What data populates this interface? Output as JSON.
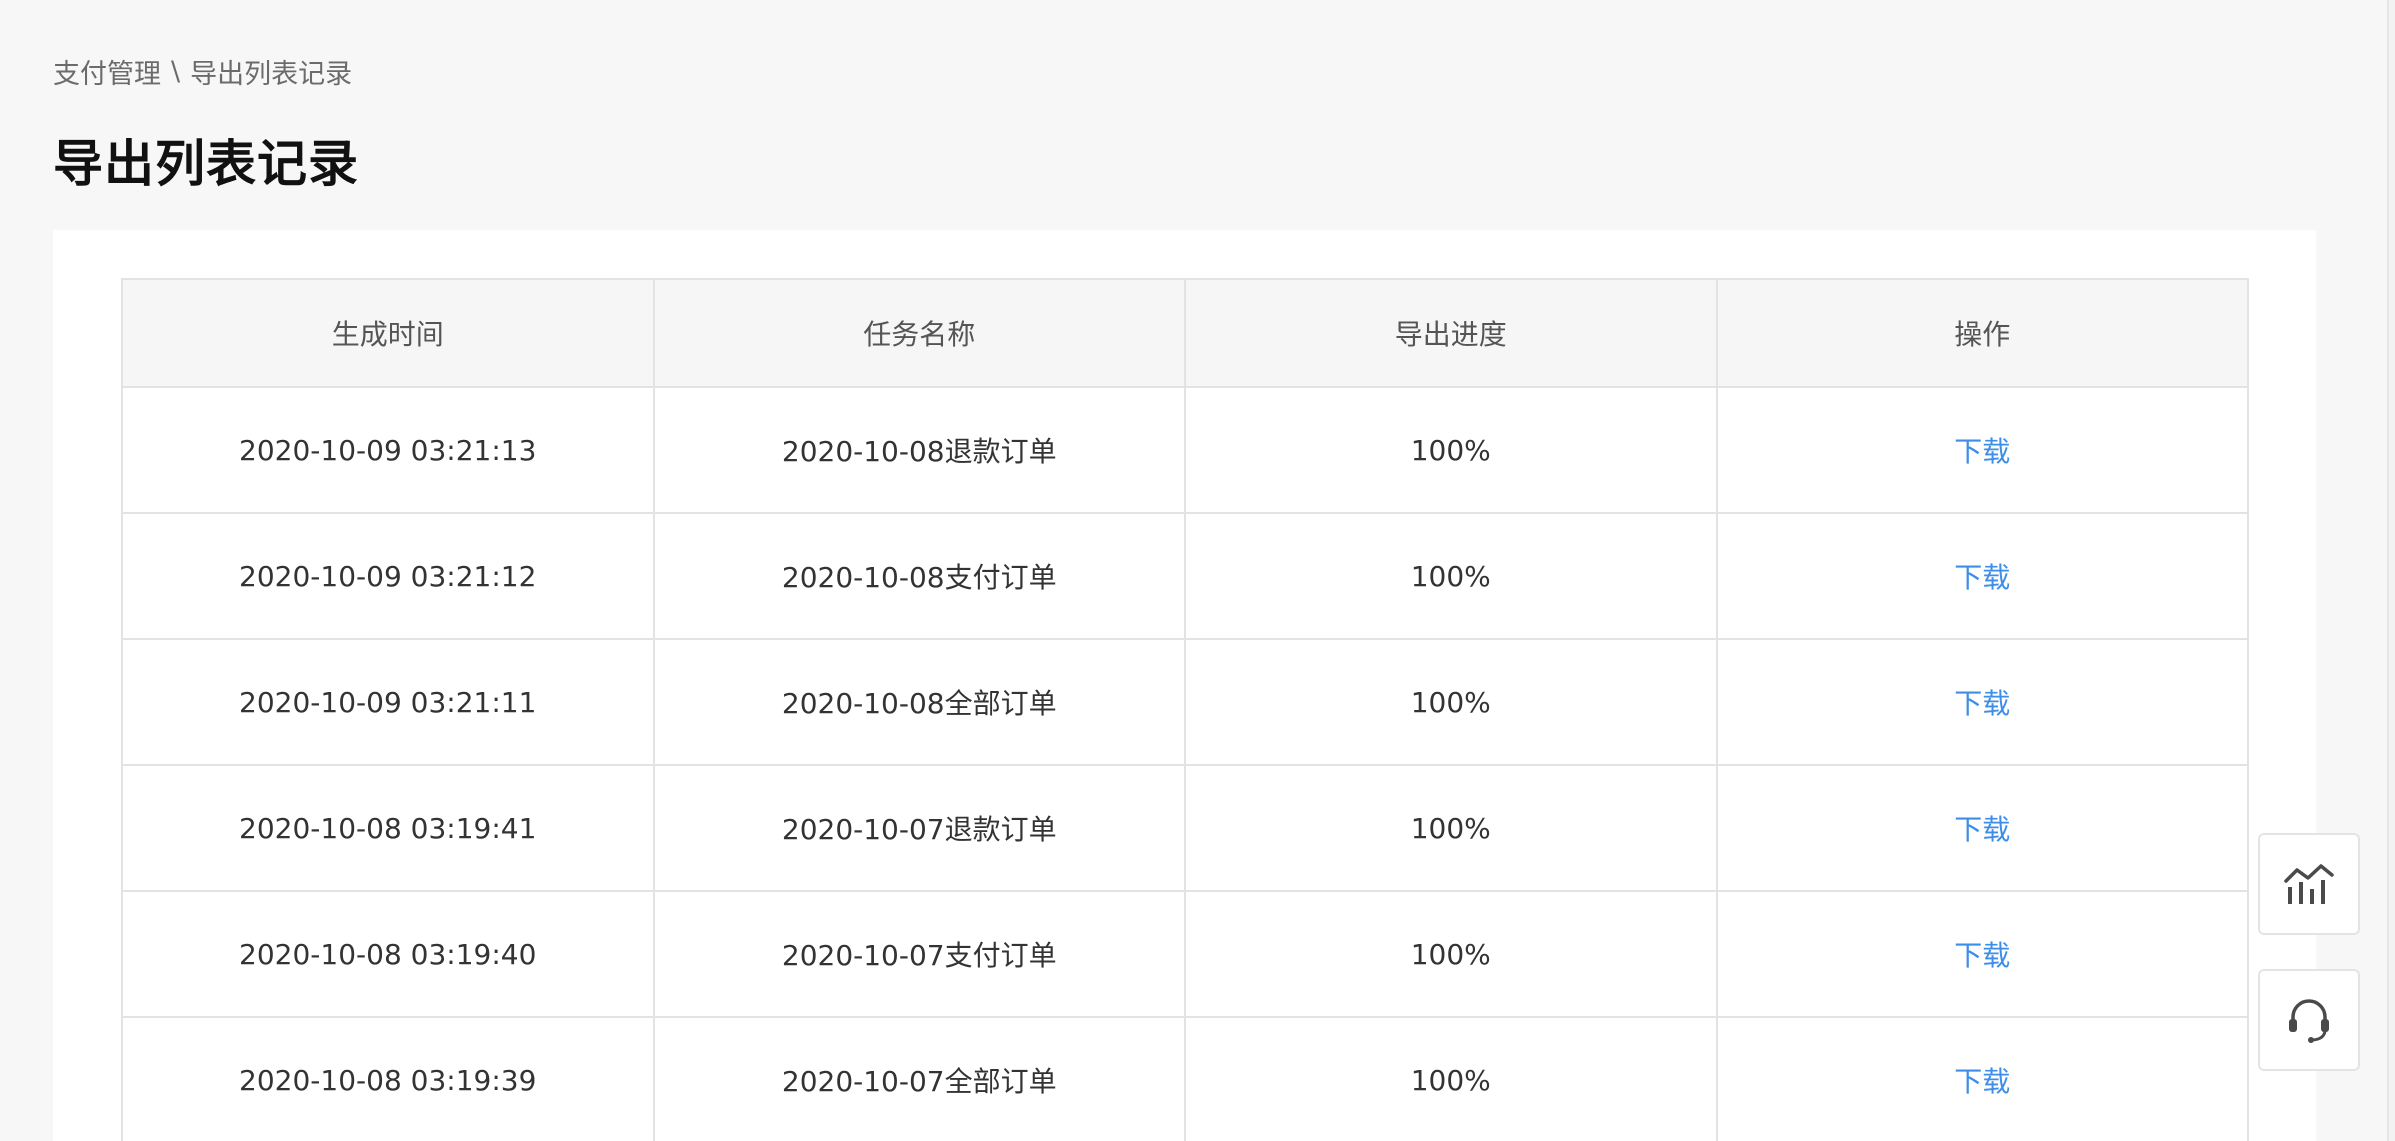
{
  "breadcrumb": {
    "parent": "支付管理",
    "separator": "\\",
    "current": "导出列表记录"
  },
  "page_title": "导出列表记录",
  "table": {
    "headers": [
      "生成时间",
      "任务名称",
      "导出进度",
      "操作"
    ],
    "rows": [
      {
        "time": "2020-10-09 03:21:13",
        "task": "2020-10-08退款订单",
        "progress": "100%",
        "action": "下载"
      },
      {
        "time": "2020-10-09 03:21:12",
        "task": "2020-10-08支付订单",
        "progress": "100%",
        "action": "下载"
      },
      {
        "time": "2020-10-09 03:21:11",
        "task": "2020-10-08全部订单",
        "progress": "100%",
        "action": "下载"
      },
      {
        "time": "2020-10-08 03:19:41",
        "task": "2020-10-07退款订单",
        "progress": "100%",
        "action": "下载"
      },
      {
        "time": "2020-10-08 03:19:40",
        "task": "2020-10-07支付订单",
        "progress": "100%",
        "action": "下载"
      },
      {
        "time": "2020-10-08 03:19:39",
        "task": "2020-10-07全部订单",
        "progress": "100%",
        "action": "下载"
      }
    ]
  },
  "floating_buttons": [
    {
      "icon": "chart-icon"
    },
    {
      "icon": "headset-icon"
    }
  ],
  "colors": {
    "link": "#3d8ee8",
    "background": "#f7f7f7",
    "header_bg": "#f6f6f6"
  }
}
